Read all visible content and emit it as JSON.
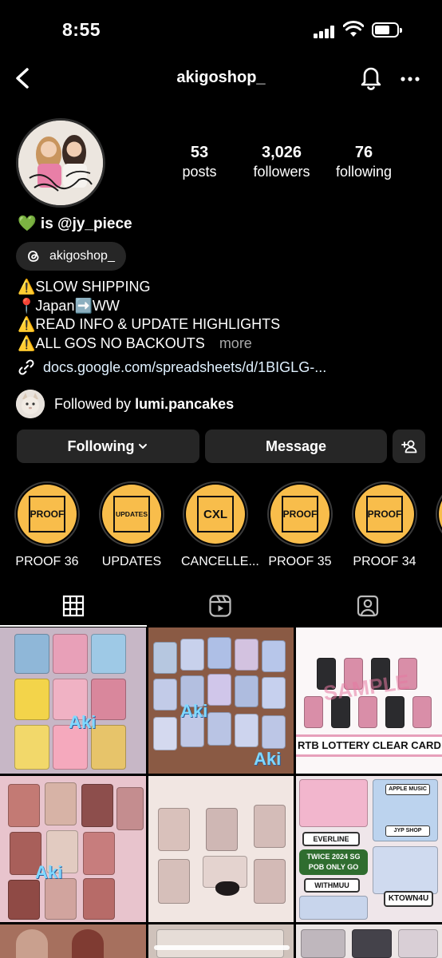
{
  "status_bar": {
    "time": "8:55"
  },
  "nav": {
    "username": "akigoshop_"
  },
  "profile": {
    "stats": [
      {
        "value": "53",
        "label": "posts"
      },
      {
        "value": "3,026",
        "label": "followers"
      },
      {
        "value": "76",
        "label": "following"
      }
    ],
    "name": "💚 is @jy_piece",
    "threads_handle": "akigoshop_",
    "bio_lines": [
      "⚠️SLOW SHIPPING",
      "📍Japan➡️WW",
      "⚠️READ INFO & UPDATE HIGHLIGHTS",
      "⚠️ALL GOS NO BACKOUTS"
    ],
    "bio_more": "more",
    "link": "docs.google.com/spreadsheets/d/1BIGLG-...",
    "followed_by_prefix": "Followed by",
    "followed_by_user": "lumi.pancakes"
  },
  "actions": {
    "following": "Following",
    "message": "Message"
  },
  "highlights": [
    {
      "icon_text": "PROOF",
      "label": "PROOF 36"
    },
    {
      "icon_text": "UPDATES",
      "label": "UPDATES"
    },
    {
      "icon_text": "CXL",
      "label": "CANCELLE..."
    },
    {
      "icon_text": "PROOF",
      "label": "PROOF 35"
    },
    {
      "icon_text": "PROOF",
      "label": "PROOF 34"
    },
    {
      "icon_text": "",
      "label": "P"
    }
  ],
  "posts": {
    "post3_caption": "RTB LOTTERY CLEAR CARD",
    "post3_watermark": "SAMPLE",
    "watermark_aki": "Aki",
    "post6_tags": [
      "EVERLINE",
      "TWICE 2024 SG POB ONLY GO",
      "WITHMUU",
      "APPLE MUSIC",
      "JYP SHOP",
      "KTOWN4U"
    ]
  },
  "colors": {
    "highlight_fill": "#f8bd4b",
    "button_bg": "#262626",
    "link": "#e0f1ff"
  }
}
